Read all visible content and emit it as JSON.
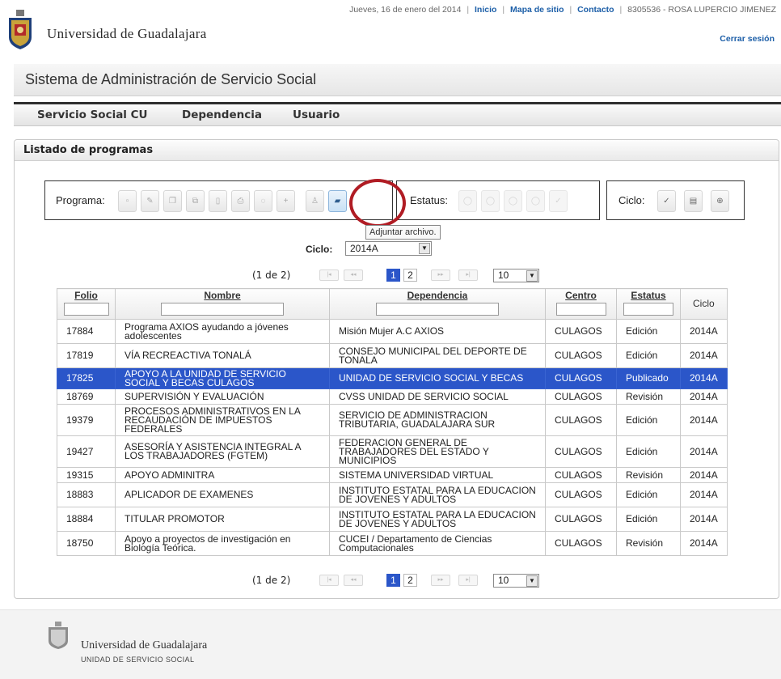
{
  "header": {
    "university_name": "Universidad de Guadalajara",
    "date": "Jueves, 16 de enero del 2014",
    "links": [
      "Inicio",
      "Mapa de sitio",
      "Contacto"
    ],
    "user": "8305536 - ROSA LUPERCIO JIMENEZ",
    "logout": "Cerrar sesión"
  },
  "system_title": "Sistema de Administración de Servicio Social",
  "nav": [
    "Servicio Social CU",
    "Dependencia",
    "Usuario"
  ],
  "panel": {
    "title": "Listado de programas",
    "toolbar": {
      "programa_label": "Programa:",
      "estatus_label": "Estatus:",
      "ciclo_label": "Ciclo:",
      "programa_icons": [
        "new-document-icon",
        "edit-icon",
        "copy-icon",
        "duplicate-icon",
        "delete-icon",
        "print-icon",
        "comment-icon",
        "add-icon",
        "user-icon",
        "attach-folder-icon"
      ],
      "estatus_icons": [
        "status-1-icon",
        "status-2-icon",
        "status-3-icon",
        "status-4-icon",
        "check-icon"
      ],
      "ciclo_icons": [
        "check-icon",
        "list-icon",
        "add-circle-icon"
      ],
      "tooltip": "Adjuntar archivo."
    },
    "ciclo_filter": {
      "label": "Ciclo:",
      "value": "2014A"
    },
    "pager": {
      "count": "(1 de 2)",
      "pages": [
        "1",
        "2"
      ],
      "current": "1",
      "page_size": "10"
    },
    "columns": [
      "Folio",
      "Nombre",
      "Dependencia",
      "Centro",
      "Estatus",
      "Ciclo"
    ],
    "rows": [
      {
        "folio": "17884",
        "nombre": "Programa AXIOS ayudando a jóvenes adolescentes",
        "dependencia": "Misión Mujer A.C AXIOS",
        "centro": "CULAGOS",
        "estatus": "Edición",
        "ciclo": "2014A"
      },
      {
        "folio": "17819",
        "nombre": "VÍA RECREACTIVA TONALÁ",
        "dependencia": "CONSEJO MUNICIPAL DEL DEPORTE DE TONALA",
        "centro": "CULAGOS",
        "estatus": "Edición",
        "ciclo": "2014A"
      },
      {
        "folio": "17825",
        "nombre": "APOYO A LA UNIDAD DE SERVICIO SOCIAL Y BECAS CULAGOS",
        "dependencia": "UNIDAD DE SERVICIO SOCIAL Y BECAS",
        "centro": "CULAGOS",
        "estatus": "Publicado",
        "ciclo": "2014A"
      },
      {
        "folio": "18769",
        "nombre": "SUPERVISIÓN Y EVALUACIÓN",
        "dependencia": "CVSS UNIDAD DE SERVICIO SOCIAL",
        "centro": "CULAGOS",
        "estatus": "Revisión",
        "ciclo": "2014A"
      },
      {
        "folio": "19379",
        "nombre": "PROCESOS ADMINISTRATIVOS EN LA RECAUDACIÓN DE IMPUESTOS FEDERALES",
        "dependencia": "SERVICIO DE ADMINISTRACION TRIBUTARIA, GUADALAJARA SUR",
        "centro": "CULAGOS",
        "estatus": "Edición",
        "ciclo": "2014A"
      },
      {
        "folio": "19427",
        "nombre": "ASESORÍA Y ASISTENCIA INTEGRAL A LOS TRABAJADORES (FGTEM)",
        "dependencia": "FEDERACION GENERAL DE TRABAJADORES DEL ESTADO Y MUNICIPIOS",
        "centro": "CULAGOS",
        "estatus": "Edición",
        "ciclo": "2014A"
      },
      {
        "folio": "19315",
        "nombre": "APOYO ADMINITRA",
        "dependencia": "SISTEMA UNIVERSIDAD VIRTUAL",
        "centro": "CULAGOS",
        "estatus": "Revisión",
        "ciclo": "2014A"
      },
      {
        "folio": "18883",
        "nombre": "APLICADOR DE EXAMENES",
        "dependencia": "INSTITUTO ESTATAL PARA LA EDUCACION DE JOVENES Y ADULTOS",
        "centro": "CULAGOS",
        "estatus": "Edición",
        "ciclo": "2014A"
      },
      {
        "folio": "18884",
        "nombre": "TITULAR PROMOTOR",
        "dependencia": "INSTITUTO ESTATAL PARA LA EDUCACION DE JOVENES Y ADULTOS",
        "centro": "CULAGOS",
        "estatus": "Edición",
        "ciclo": "2014A"
      },
      {
        "folio": "18750",
        "nombre": "Apoyo a proyectos de investigación en Biología Teórica.",
        "dependencia": "CUCEI / Departamento de Ciencias Computacionales",
        "centro": "CULAGOS",
        "estatus": "Revisión",
        "ciclo": "2014A"
      }
    ],
    "selected_row": 2
  },
  "footer": {
    "university_name": "Universidad de Guadalajara",
    "unit": "UNIDAD DE SERVICIO SOCIAL"
  },
  "colors": {
    "selection": "#2b56c9",
    "link": "#1d5fa8",
    "highlight_ring": "#b01c24"
  }
}
